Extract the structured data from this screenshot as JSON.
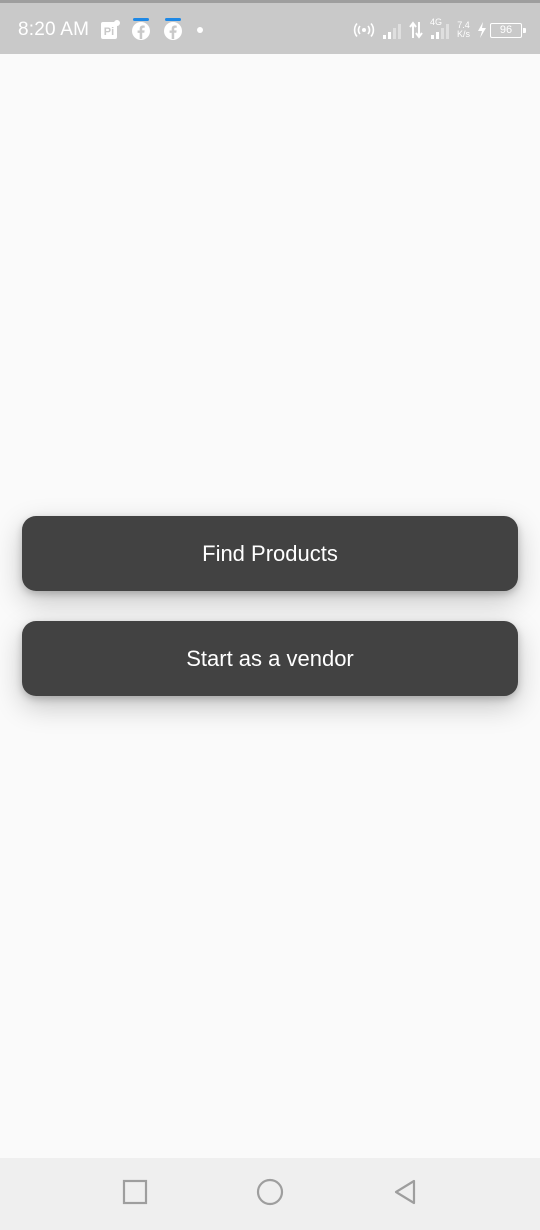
{
  "status_bar": {
    "time": "8:20 AM",
    "network_type": "4G",
    "speed_value": "7.4",
    "speed_unit": "K/s",
    "battery_level": "96",
    "icons": [
      "pi-notification-icon",
      "facebook-icon",
      "facebook-icon",
      "more-dot-icon",
      "hotspot-icon",
      "signal-icon",
      "data-arrows-icon",
      "signal-4g-icon",
      "charging-icon"
    ]
  },
  "main": {
    "find_products_label": "Find Products",
    "start_vendor_label": "Start as a vendor"
  },
  "navigation": {
    "icons": [
      "recents-square-icon",
      "home-circle-icon",
      "back-triangle-icon"
    ]
  },
  "colors": {
    "button_bg": "#424242",
    "button_text": "#ffffff",
    "background": "#fafafa",
    "status_bar_bg": "#c9c9c9",
    "nav_bar_bg": "#efefef",
    "facebook_accent": "#1e88e5"
  }
}
